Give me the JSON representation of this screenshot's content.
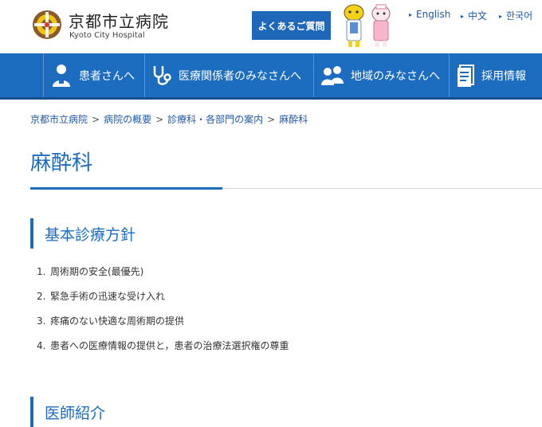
{
  "header": {
    "logo_title": "京都市立病院",
    "logo_sub": "Kyoto City Hospital",
    "faq_label": "よくあるご質問",
    "languages": [
      "English",
      "中文",
      "한국어"
    ]
  },
  "nav": {
    "items": [
      {
        "label": "患者さんへ",
        "icon": "patient-icon"
      },
      {
        "label": "医療関係者のみなさんへ",
        "icon": "stethoscope-icon"
      },
      {
        "label": "地域のみなさんへ",
        "icon": "people-icon"
      },
      {
        "label": "採用情報",
        "icon": "document-icon"
      }
    ]
  },
  "breadcrumb": {
    "items": [
      "京都市立病院",
      "病院の概要",
      "診療科・各部門の案内",
      "麻酔科"
    ],
    "separator": ">"
  },
  "page": {
    "title": "麻酔科"
  },
  "sections": {
    "policy": {
      "heading": "基本診療方針",
      "items": [
        {
          "num": "1.",
          "text": "周術期の安全(最優先)"
        },
        {
          "num": "2.",
          "text": "緊急手術の迅速な受け入れ"
        },
        {
          "num": "3.",
          "text": "疼痛のない快適な周術期の提供"
        },
        {
          "num": "4.",
          "text": "患者への医療情報の提供と，患者の治療法選択権の尊重"
        }
      ]
    },
    "doctors": {
      "heading": "医師紹介"
    }
  },
  "colors": {
    "brand_blue": "#1c6cbf",
    "faq_blue": "#1f67b8",
    "link_blue": "#1e5aa8"
  }
}
